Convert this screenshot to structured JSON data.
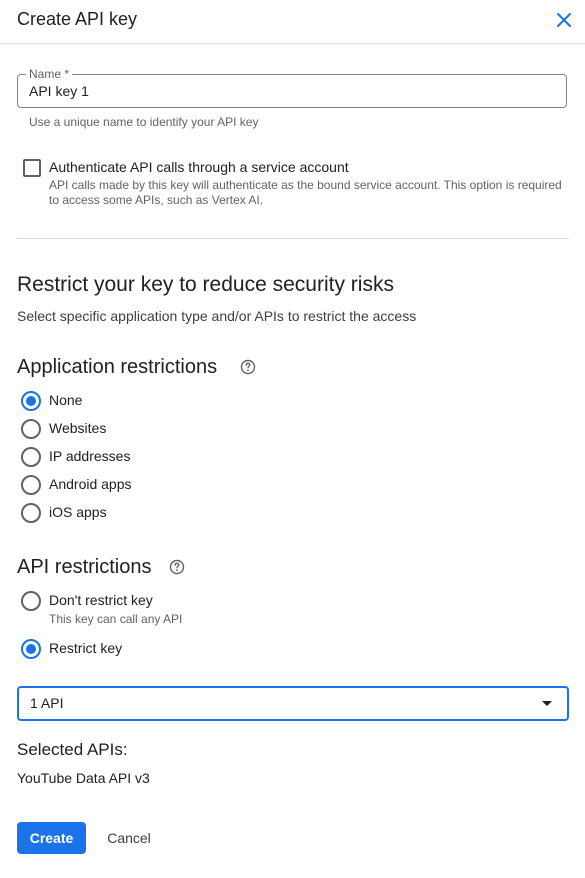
{
  "dialog": {
    "title": "Create API key",
    "close_icon": "close-icon"
  },
  "name_field": {
    "label": "Name *",
    "value": "API key 1",
    "hint": "Use a unique name to identify your API key"
  },
  "service_account": {
    "checked": false,
    "label": "Authenticate API calls through a service account",
    "description": "API calls made by this key will authenticate as the bound service account. This option is required to access some APIs, such as Vertex AI."
  },
  "restrict_section": {
    "title": "Restrict your key to reduce security risks",
    "subtitle": "Select specific application type and/or APIs to restrict the access"
  },
  "application_restrictions": {
    "title": "Application restrictions",
    "help_icon": "help-circle-icon",
    "selected": "None",
    "options": [
      "None",
      "Websites",
      "IP addresses",
      "Android apps",
      "iOS apps"
    ]
  },
  "api_restrictions": {
    "title": "API restrictions",
    "help_icon": "help-circle-icon",
    "selected": "Restrict key",
    "options": [
      {
        "label": "Don't restrict key",
        "description": "This key can call any API"
      },
      {
        "label": "Restrict key",
        "description": ""
      }
    ],
    "select_value": "1 API",
    "selected_apis_title": "Selected APIs:",
    "selected_apis": [
      "YouTube Data API v3"
    ]
  },
  "actions": {
    "create_label": "Create",
    "cancel_label": "Cancel"
  },
  "colors": {
    "accent": "#1a73e8",
    "text": "#202124",
    "secondary_text": "#5f6368",
    "divider": "#dadce0"
  }
}
